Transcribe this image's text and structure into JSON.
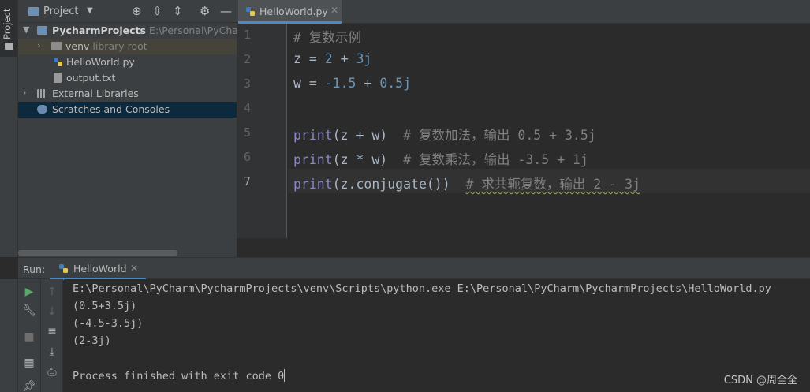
{
  "toolstrip": {
    "project_label": "Project"
  },
  "project_panel": {
    "title": "Project",
    "header_icons": [
      "crosshair-icon",
      "expand-all-icon",
      "collapse-all-icon",
      "gear-icon",
      "minimize-icon"
    ],
    "tree": [
      {
        "label": "PycharmProjects",
        "hint": "E:\\Personal\\PyCharm\\",
        "icon": "folder-icon"
      },
      {
        "label": "venv",
        "hint": "library root",
        "icon": "folder-icon"
      },
      {
        "label": "HelloWorld.py",
        "icon": "python-file-icon"
      },
      {
        "label": "output.txt",
        "icon": "text-file-icon"
      },
      {
        "label": "External Libraries",
        "icon": "library-icon"
      },
      {
        "label": "Scratches and Consoles",
        "icon": "scratches-icon"
      }
    ]
  },
  "editor": {
    "tab_label": "HelloWorld.py",
    "line_numbers": [
      "1",
      "2",
      "3",
      "4",
      "5",
      "6",
      "7"
    ],
    "lines": [
      {
        "comment": "# 复数示例"
      },
      {
        "var": "z",
        "op": " = ",
        "a": "2",
        "plus": " + ",
        "b": "3j"
      },
      {
        "var": "w",
        "op": " = ",
        "a": "-1.5",
        "plus": " + ",
        "b": "0.5j"
      },
      {},
      {
        "fn": "print",
        "args": "(z + w)",
        "comment": "# 复数加法，输出 0.5 + 3.5j"
      },
      {
        "fn": "print",
        "args": "(z * w)",
        "comment": "# 复数乘法，输出 -3.5 + 1j"
      },
      {
        "fn": "print",
        "args": "(z.conjugate())",
        "comment": "# 求共轭复数，输出 2 - 3j"
      }
    ]
  },
  "run_panel": {
    "label": "Run:",
    "tab_label": "HelloWorld",
    "console": [
      "E:\\Personal\\PyCharm\\PycharmProjects\\venv\\Scripts\\python.exe E:\\Personal\\PyCharm\\PycharmProjects\\HelloWorld.py",
      "(0.5+3.5j)",
      "(-4.5-3.5j)",
      "(2-3j)",
      "",
      "Process finished with exit code 0"
    ]
  },
  "watermark": "CSDN @周全全",
  "colors": {
    "accent": "#4a88c7",
    "selection": "#0d293e",
    "comment": "#808080",
    "number": "#6897bb",
    "builtin": "#8888c6"
  }
}
